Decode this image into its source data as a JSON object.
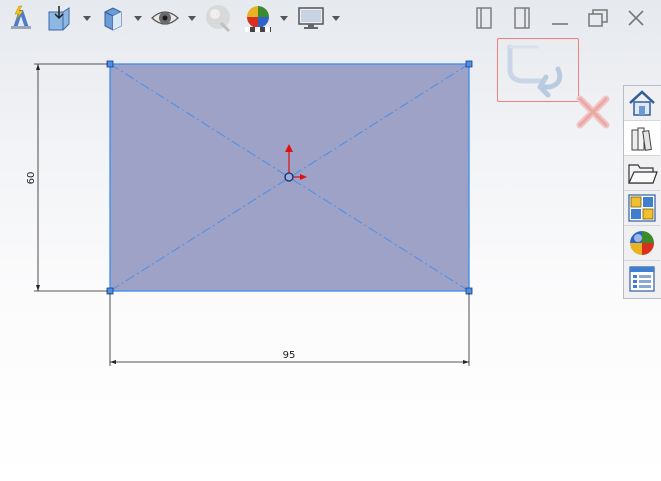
{
  "toolbar": {
    "items": [
      {
        "name": "view-orientation-icon"
      },
      {
        "name": "section-view-icon"
      },
      {
        "name": "display-style-icon"
      },
      {
        "name": "hide-show-items-icon"
      },
      {
        "name": "edit-appearance-icon"
      },
      {
        "name": "apply-scene-icon"
      },
      {
        "name": "view-settings-icon"
      }
    ]
  },
  "window_controls": [
    "restore-left-icon",
    "restore-right-icon",
    "minimize-icon",
    "maximize-icon",
    "close-icon"
  ],
  "confirmation_corner": {
    "ok": "exit-sketch-icon",
    "cancel": "cancel-sketch-icon"
  },
  "task_pane": {
    "tabs": [
      {
        "name": "tab-solidworks-resources",
        "icon": "home-icon"
      },
      {
        "name": "tab-design-library",
        "icon": "books-icon"
      },
      {
        "name": "tab-file-explorer",
        "icon": "folder-icon"
      },
      {
        "name": "tab-view-palette",
        "icon": "view-palette-icon"
      },
      {
        "name": "tab-appearances",
        "icon": "appearances-icon"
      },
      {
        "name": "tab-custom-properties",
        "icon": "properties-icon"
      }
    ]
  },
  "sketch": {
    "dimension_vertical": "60",
    "dimension_horizontal": "95",
    "fill_color": "#9a9dc4",
    "edge_color": "#3b8eea",
    "origin_x_color": "#dd1111",
    "origin_y_color": "#dd1111"
  }
}
